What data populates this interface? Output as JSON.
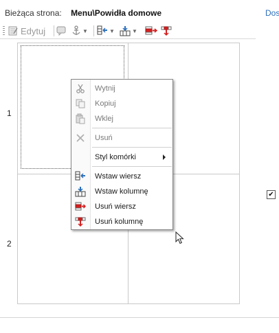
{
  "header": {
    "current_page_label": "Bieżąca strona:",
    "current_page_value": "Menu\\Powidła domowe",
    "link_text": "Dos"
  },
  "toolbar": {
    "edit_label": "Edytuj",
    "icons": [
      "page-edit-icon",
      "comment-icon",
      "anchor-icon",
      "insert-row-icon",
      "insert-column-icon",
      "delete-row-icon",
      "delete-column-icon"
    ]
  },
  "grid": {
    "rows": [
      "1",
      "2"
    ]
  },
  "context_menu": {
    "items": [
      {
        "label": "Wytnij",
        "icon": "scissors-icon",
        "enabled": false
      },
      {
        "label": "Kopiuj",
        "icon": "copy-icon",
        "enabled": false
      },
      {
        "label": "Wklej",
        "icon": "paste-icon",
        "enabled": false
      },
      {
        "label": "Usuń",
        "icon": "delete-x-icon",
        "enabled": false
      },
      {
        "label": "Styl komórki",
        "icon": "",
        "enabled": true,
        "submenu": true
      },
      {
        "label": "Wstaw wiersz",
        "icon": "insert-row-icon",
        "enabled": true
      },
      {
        "label": "Wstaw kolumnę",
        "icon": "insert-column-icon",
        "enabled": true
      },
      {
        "label": "Usuń wiersz",
        "icon": "delete-row-icon",
        "enabled": true
      },
      {
        "label": "Usuń kolumnę",
        "icon": "delete-column-icon",
        "enabled": true
      }
    ]
  },
  "checkbox": {
    "checked": true,
    "glyph": "✔"
  },
  "colors": {
    "link": "#2a6ebb",
    "border": "#c9c9c9",
    "red_icon": "#d42020",
    "blue_icon": "#2a6ebb"
  }
}
